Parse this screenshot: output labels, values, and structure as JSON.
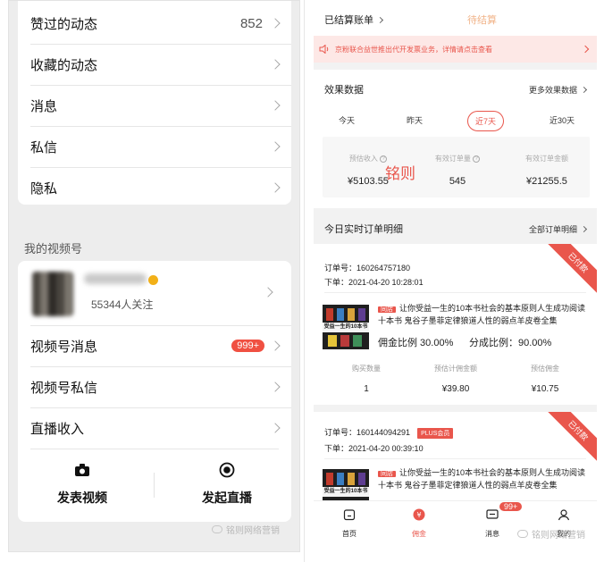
{
  "left": {
    "menu": [
      {
        "label": "赞过的动态",
        "value": "852"
      },
      {
        "label": "收藏的动态",
        "value": ""
      },
      {
        "label": "消息",
        "value": ""
      },
      {
        "label": "私信",
        "value": ""
      },
      {
        "label": "隐私",
        "value": ""
      }
    ],
    "section_title": "我的视频号",
    "account": {
      "followers": "55344人关注"
    },
    "video_menu": [
      {
        "label": "视频号消息",
        "badge": "999+"
      },
      {
        "label": "视频号私信"
      },
      {
        "label": "直播收入"
      }
    ],
    "actions": {
      "post_video": "发表视频",
      "go_live": "发起直播"
    },
    "watermark": "铭则网络营销"
  },
  "right": {
    "settled": "已结算账单",
    "pending": "待结算",
    "notice": "京粉联合益世推出代开发票业务，详情请点击查看",
    "effect": {
      "title": "效果数据",
      "more": "更多效果数据"
    },
    "tabs": [
      "今天",
      "昨天",
      "近7天",
      "近30天"
    ],
    "active_tab": "近7天",
    "stats": [
      {
        "label": "预估收入",
        "value": "¥5103.55"
      },
      {
        "label": "有效订单量",
        "value": "545"
      },
      {
        "label": "有效订单金额",
        "value": "¥21255.5"
      }
    ],
    "overlay_watermark": "铭则",
    "orders_head": {
      "title": "今日实时订单明细",
      "more": "全部订单明细"
    },
    "orders": [
      {
        "number": "订单号：160264757180",
        "time": "下单：2021-04-20 10:28:01",
        "status": "已付款",
        "plus": "",
        "tag": "同店",
        "title": "让你受益一生的10本书社会的基本原则人生成功阅读十本书 鬼谷子墨菲定律狼道人性的弱点羊皮卷全集",
        "cover_text": "受益一生的10本书",
        "commission_rate": "佣金比例 30.00%",
        "share_rate": "分成比例：90.00%",
        "columns": [
          {
            "label": "购买数量",
            "value": "1"
          },
          {
            "label": "预估计佣金额",
            "value": "¥39.80"
          },
          {
            "label": "预估佣金",
            "value": "¥10.75"
          }
        ]
      },
      {
        "number": "订单号：160144094291",
        "time": "下单：2021-04-20 00:39:10",
        "status": "已付款",
        "plus": "PLUS会员",
        "tag": "同店",
        "title": "让你受益一生的10本书社会的基本原则人生成功阅读十本书 鬼谷子墨菲定律狼道人性的弱点羊皮卷全集",
        "cover_text": "受益一生的10本书"
      }
    ],
    "tabbar": [
      {
        "label": "首页",
        "icon": "home-icon"
      },
      {
        "label": "佣金",
        "icon": "commission-icon"
      },
      {
        "label": "消息",
        "icon": "message-icon",
        "badge": "99+"
      },
      {
        "label": "我的",
        "icon": "profile-icon"
      }
    ],
    "watermark": "铭则网络营销",
    "accent": "#e9564c"
  }
}
